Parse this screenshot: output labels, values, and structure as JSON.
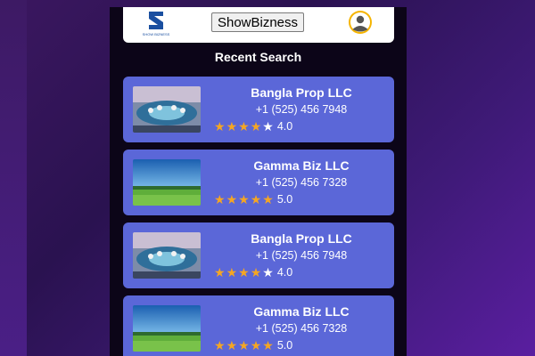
{
  "header": {
    "logo_text": "SHOW BIZNESS",
    "brand_label": "ShowBizness",
    "avatar_icon": "user-avatar-icon"
  },
  "main": {
    "section_title": "Recent Search",
    "cards": [
      {
        "name": "Bangla Prop LLC",
        "phone": "+1 (525) 456 7948",
        "rating": "4.0",
        "stars": 4,
        "thumb": "lounge-image"
      },
      {
        "name": "Gamma Biz LLC",
        "phone": "+1 (525) 456 7328",
        "rating": "5.0",
        "stars": 5,
        "thumb": "field-image"
      },
      {
        "name": "Bangla Prop LLC",
        "phone": "+1 (525) 456 7948",
        "rating": "4.0",
        "stars": 4,
        "thumb": "lounge-image"
      },
      {
        "name": "Gamma Biz LLC",
        "phone": "+1 (525) 456 7328",
        "rating": "5.0",
        "stars": 5,
        "thumb": "field-image"
      }
    ]
  },
  "colors": {
    "card_bg": "#5b67d8",
    "star_on": "#f5a623",
    "star_off": "#ffffff",
    "logo_blue": "#1a4fa0"
  }
}
